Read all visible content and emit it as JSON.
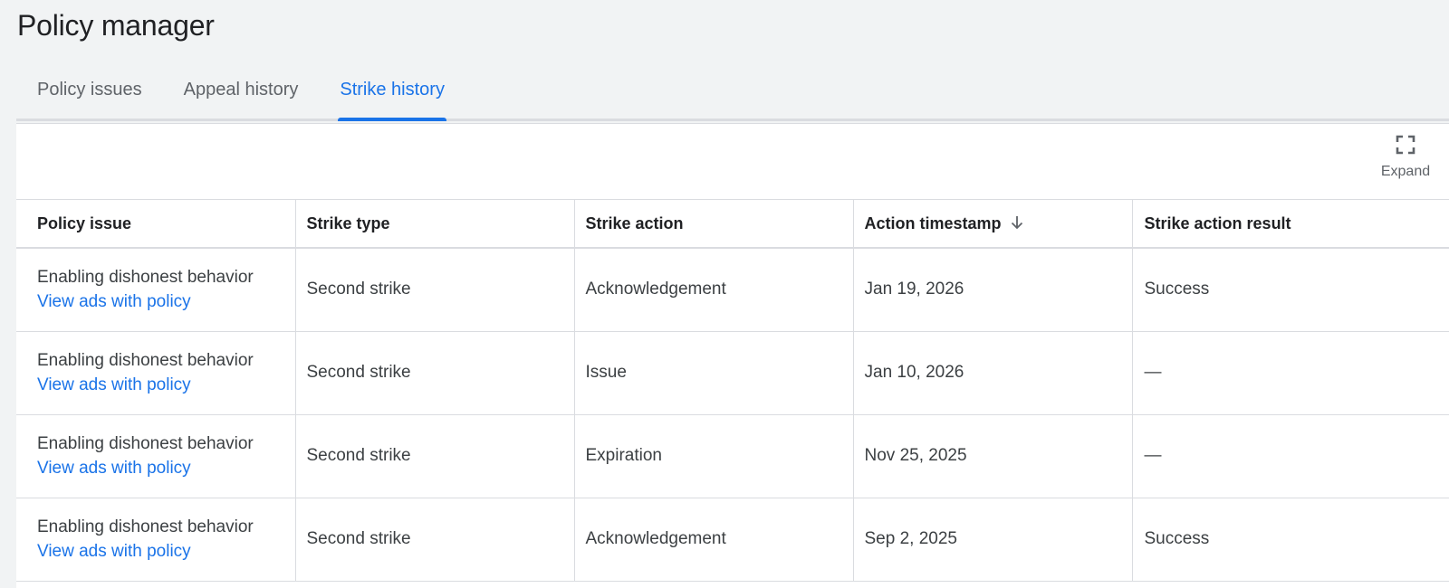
{
  "page": {
    "title": "Policy manager"
  },
  "tabs": [
    {
      "label": "Policy issues",
      "active": false
    },
    {
      "label": "Appeal history",
      "active": false
    },
    {
      "label": "Strike history",
      "active": true
    }
  ],
  "toolbar": {
    "expand_label": "Expand",
    "expand_icon": "fullscreen-icon"
  },
  "table": {
    "columns": [
      "Policy issue",
      "Strike type",
      "Strike action",
      "Action timestamp",
      "Strike action result"
    ],
    "sorted_column": "Action timestamp",
    "sort_direction": "descending",
    "rows": [
      {
        "policy_issue": "Enabling dishonest behavior",
        "link": "View ads with policy",
        "strike_type": "Second strike",
        "strike_action": "Acknowledgement",
        "timestamp": "Jan 19, 2026",
        "result": "Success"
      },
      {
        "policy_issue": "Enabling dishonest behavior",
        "link": "View ads with policy",
        "strike_type": "Second strike",
        "strike_action": "Issue",
        "timestamp": "Jan 10, 2026",
        "result": "—"
      },
      {
        "policy_issue": "Enabling dishonest behavior",
        "link": "View ads with policy",
        "strike_type": "Second strike",
        "strike_action": "Expiration",
        "timestamp": "Nov 25, 2025",
        "result": "—"
      },
      {
        "policy_issue": "Enabling dishonest behavior",
        "link": "View ads with policy",
        "strike_type": "Second strike",
        "strike_action": "Acknowledgement",
        "timestamp": "Sep 2, 2025",
        "result": "Success"
      }
    ]
  },
  "colors": {
    "accent": "#1a73e8",
    "background": "#f1f3f4",
    "text": "#202124",
    "muted": "#5f6368",
    "border": "#dadce0"
  }
}
